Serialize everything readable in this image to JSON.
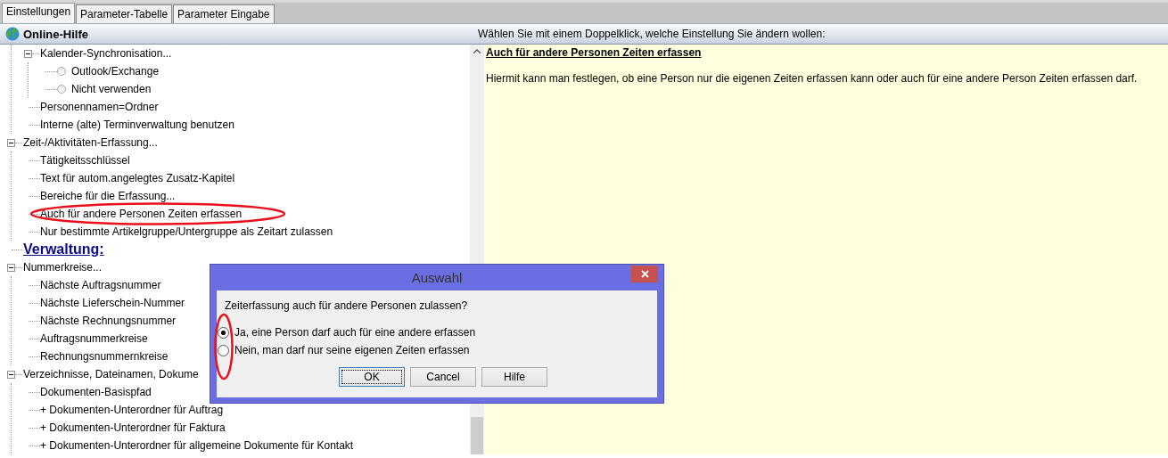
{
  "tabs": [
    {
      "label": "Einstellungen",
      "selected": true
    },
    {
      "label": "Parameter-Tabelle",
      "selected": false
    },
    {
      "label": "Parameter Eingabe",
      "selected": false
    }
  ],
  "header": {
    "left_title": "Online-Hilfe",
    "right_title": "Wählen Sie mit einem Doppelklick, welche Einstellung Sie ändern wollen:"
  },
  "tree": [
    {
      "kind": "group",
      "children": [
        {
          "kind": "node",
          "label": "Kalender-Synchronisation...",
          "expanded": true,
          "children": [
            {
              "kind": "radio",
              "label": "Outlook/Exchange",
              "selected": false
            },
            {
              "kind": "radio",
              "label": "Nicht verwenden",
              "selected": false
            }
          ]
        },
        {
          "kind": "node",
          "label": "Personennamen=Ordner"
        },
        {
          "kind": "node",
          "label": "Interne (alte) Terminverwaltung benutzen"
        }
      ]
    },
    {
      "kind": "node",
      "label": "Zeit-/Aktivitäten-Erfassung...",
      "expanded": true,
      "children": [
        {
          "kind": "node",
          "label": "Tätigkeitsschlüssel"
        },
        {
          "kind": "node",
          "label": "Text für autom.angelegtes Zusatz-Kapitel"
        },
        {
          "kind": "node",
          "label": "Bereiche für die Erfassung..."
        },
        {
          "kind": "node",
          "label": "Auch für andere Personen Zeiten erfassen",
          "circled": true
        },
        {
          "kind": "node",
          "label": "Nur bestimmte Artikelgruppe/Untergruppe als Zeitart zulassen"
        }
      ]
    },
    {
      "kind": "heading",
      "label": "Verwaltung:"
    },
    {
      "kind": "node",
      "label": "Nummerkreise...",
      "expanded": true,
      "children": [
        {
          "kind": "node",
          "label": "Nächste Auftragsnummer"
        },
        {
          "kind": "node",
          "label": "Nächste Lieferschein-Nummer"
        },
        {
          "kind": "node",
          "label": "Nächste Rechnungsnummer"
        },
        {
          "kind": "node",
          "label": "Auftragsnummerkreise"
        },
        {
          "kind": "node",
          "label": "Rechnungsnummernkreise"
        }
      ]
    },
    {
      "kind": "node",
      "label": "Verzeichnisse, Dateinamen, Dokume",
      "expanded": true,
      "children": [
        {
          "kind": "node",
          "label": "Dokumenten-Basispfad"
        },
        {
          "kind": "node",
          "label": "+ Dokumenten-Unterordner für Auftrag"
        },
        {
          "kind": "node",
          "label": "+ Dokumenten-Unterordner für Faktura"
        },
        {
          "kind": "node",
          "label": "+ Dokumenten-Unterordner für allgemeine Dokumente für Kontakt"
        }
      ]
    }
  ],
  "help": {
    "title": "Auch für andere Personen Zeiten erfassen",
    "text": "Hiermit kann man festlegen, ob eine Person nur die eigenen Zeiten erfassen kann oder auch für eine andere Person Zeiten erfassen darf."
  },
  "dialog": {
    "title": "Auswahl",
    "question": "Zeiterfassung auch für andere Personen zulassen?",
    "options_circled": true,
    "options": [
      {
        "label": "Ja, eine Person darf auch für eine andere erfassen",
        "selected": true
      },
      {
        "label": "Nein, man darf nur seine eigenen Zeiten erfassen",
        "selected": false
      }
    ],
    "buttons": [
      {
        "label": "OK",
        "default": true
      },
      {
        "label": "Cancel",
        "default": false
      },
      {
        "label": "Hilfe",
        "default": false
      }
    ]
  }
}
